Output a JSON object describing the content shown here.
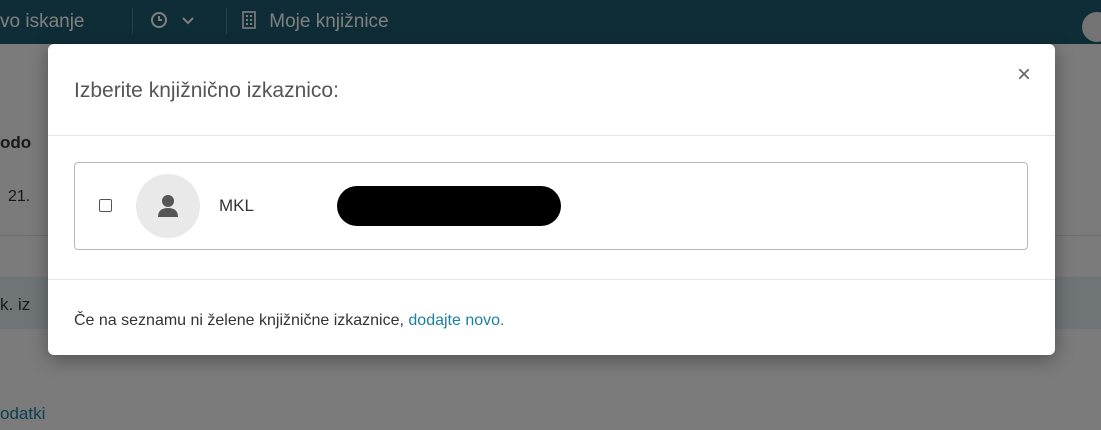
{
  "topbar": {
    "search_label": "vo iskanje",
    "history_icon": "clock-icon",
    "history_dropdown_icon": "chevron-down-icon",
    "libraries_icon": "building-icon",
    "libraries_label": "Moje knjižnice"
  },
  "background": {
    "heading_fragment": "odo",
    "date_fragment": "21.",
    "section_fragment": "k. iz",
    "link_fragment": "odatki"
  },
  "modal": {
    "title": "Izberite knjižnično izkaznico:",
    "close_label": "×",
    "cards": [
      {
        "id_prefix": "MKL",
        "selected": false,
        "avatar_icon": "user-icon"
      }
    ],
    "footer_text": "Če na seznamu ni želene knjižnične izkaznice, ",
    "footer_link": "dodajte novo."
  },
  "colors": {
    "topbar": "#1f5a6e",
    "link": "#1a7fa6",
    "backdrop": "rgba(0,0,0,0.5)"
  }
}
